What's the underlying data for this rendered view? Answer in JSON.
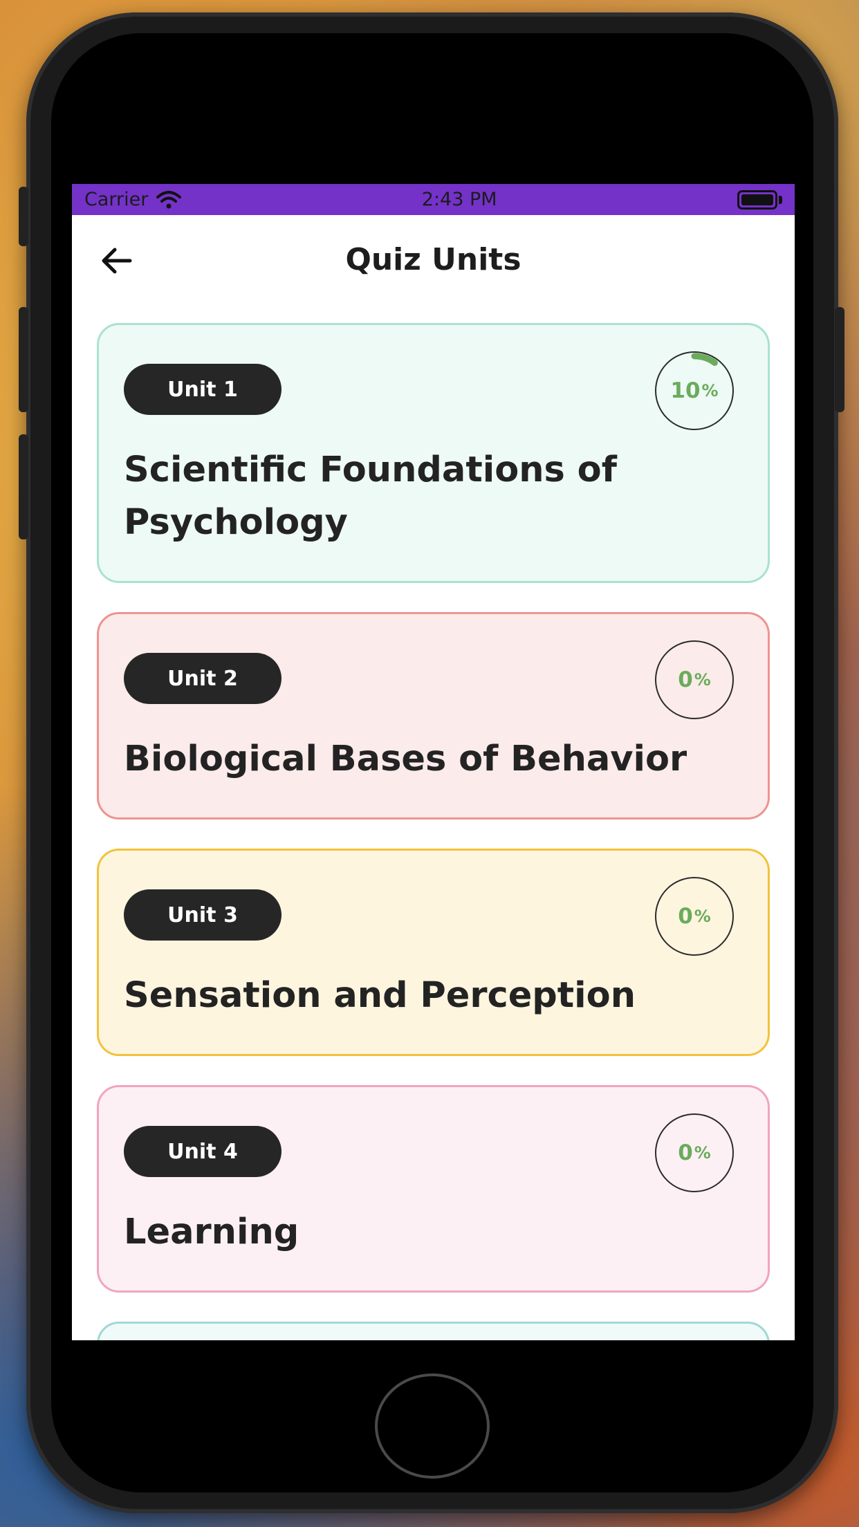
{
  "status_bar": {
    "carrier": "Carrier",
    "time": "2:43 PM"
  },
  "header": {
    "title": "Quiz Units",
    "back_icon": "arrow-left-icon"
  },
  "units": [
    {
      "pill": "Unit 1",
      "title": "Scientific Foundations of Psychology",
      "progress": 10,
      "bg": "#eefaf6",
      "border": "#a8e2d3"
    },
    {
      "pill": "Unit 2",
      "title": "Biological Bases of Behavior",
      "progress": 0,
      "bg": "#fbebea",
      "border": "#ed9490"
    },
    {
      "pill": "Unit 3",
      "title": "Sensation and Perception",
      "progress": 0,
      "bg": "#fef5df",
      "border": "#f2c23b"
    },
    {
      "pill": "Unit 4",
      "title": "Learning",
      "progress": 0,
      "bg": "#fdf0f4",
      "border": "#f1a4c0"
    }
  ],
  "colors": {
    "status_bar": "#7432c8",
    "progress": "#6aac5c",
    "pill": "#262626"
  }
}
